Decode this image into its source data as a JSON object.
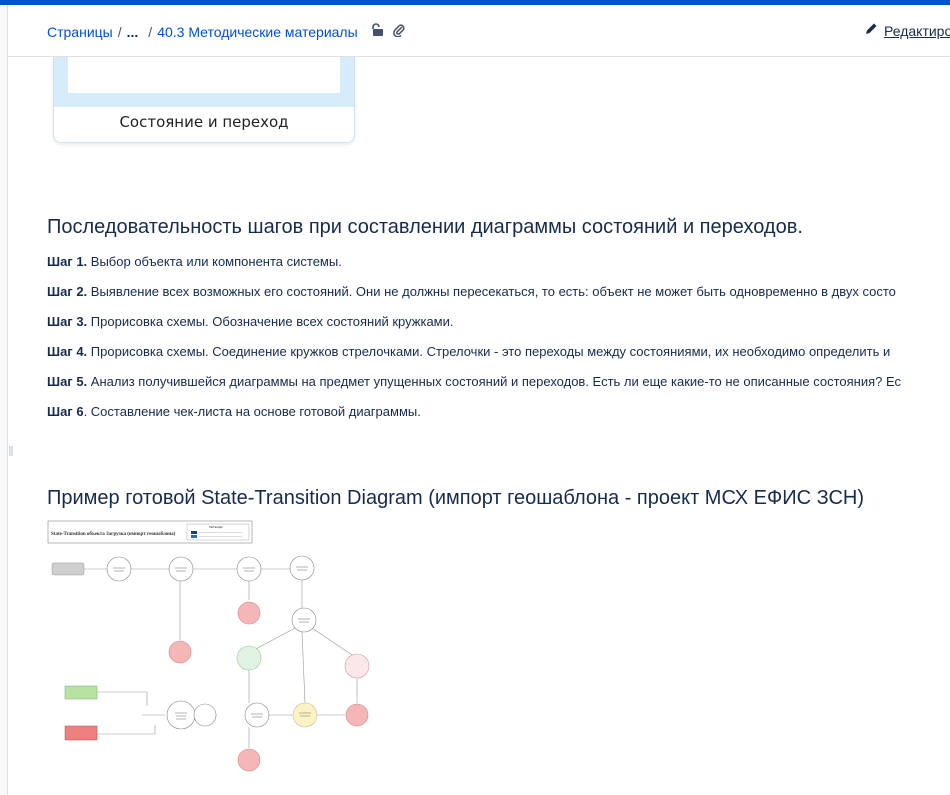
{
  "breadcrumb": {
    "root": "Страницы",
    "ellipsis": "...",
    "current": "40.3 Методические материалы"
  },
  "header": {
    "edit_label": "Редактиро"
  },
  "thumbnail": {
    "caption": "Состояние и переход"
  },
  "section1": {
    "title": "Последовательность шагов при составлении диаграммы состояний и переходов."
  },
  "steps": [
    {
      "label": "Шаг 1.",
      "text": " Выбор объекта или компонента системы."
    },
    {
      "label": "Шаг 2.",
      "text": " Выявление всех возможных его состояний. Они не должны пересекаться, то есть: объект не может быть одновременно в двух состо"
    },
    {
      "label": "Шаг 3.",
      "text": " Прорисовка схемы. Обозначение всех состояний кружками."
    },
    {
      "label": "Шаг 4.",
      "text": " Прорисовка схемы. Соединение кружков стрелочками. Стрелочки - это переходы между состояниями, их необходимо определить и"
    },
    {
      "label": "Шаг 5.",
      "text": " Анализ получившейся диаграммы на предмет упущенных состояний и переходов. Есть ли еще какие-то не описанные состояния? Ес"
    },
    {
      "label": "Шаг 6",
      "text": ". Составление чек-листа на основе готовой диаграммы."
    }
  ],
  "section2": {
    "title": "Пример готовой State-Transition Diagram (импорт геошаблона - проект МСХ ЕФИС ЗСН)"
  },
  "diagram": {
    "title": "State-Transition объекта Загрузка (импорт геошаблона)",
    "legend_title": "ЛЕГЕНДА"
  },
  "colors": {
    "accent": "#0052cc",
    "state_red": "#f4b6b6",
    "state_green": "#dff0d8",
    "state_yellow": "#fcf3c5"
  }
}
